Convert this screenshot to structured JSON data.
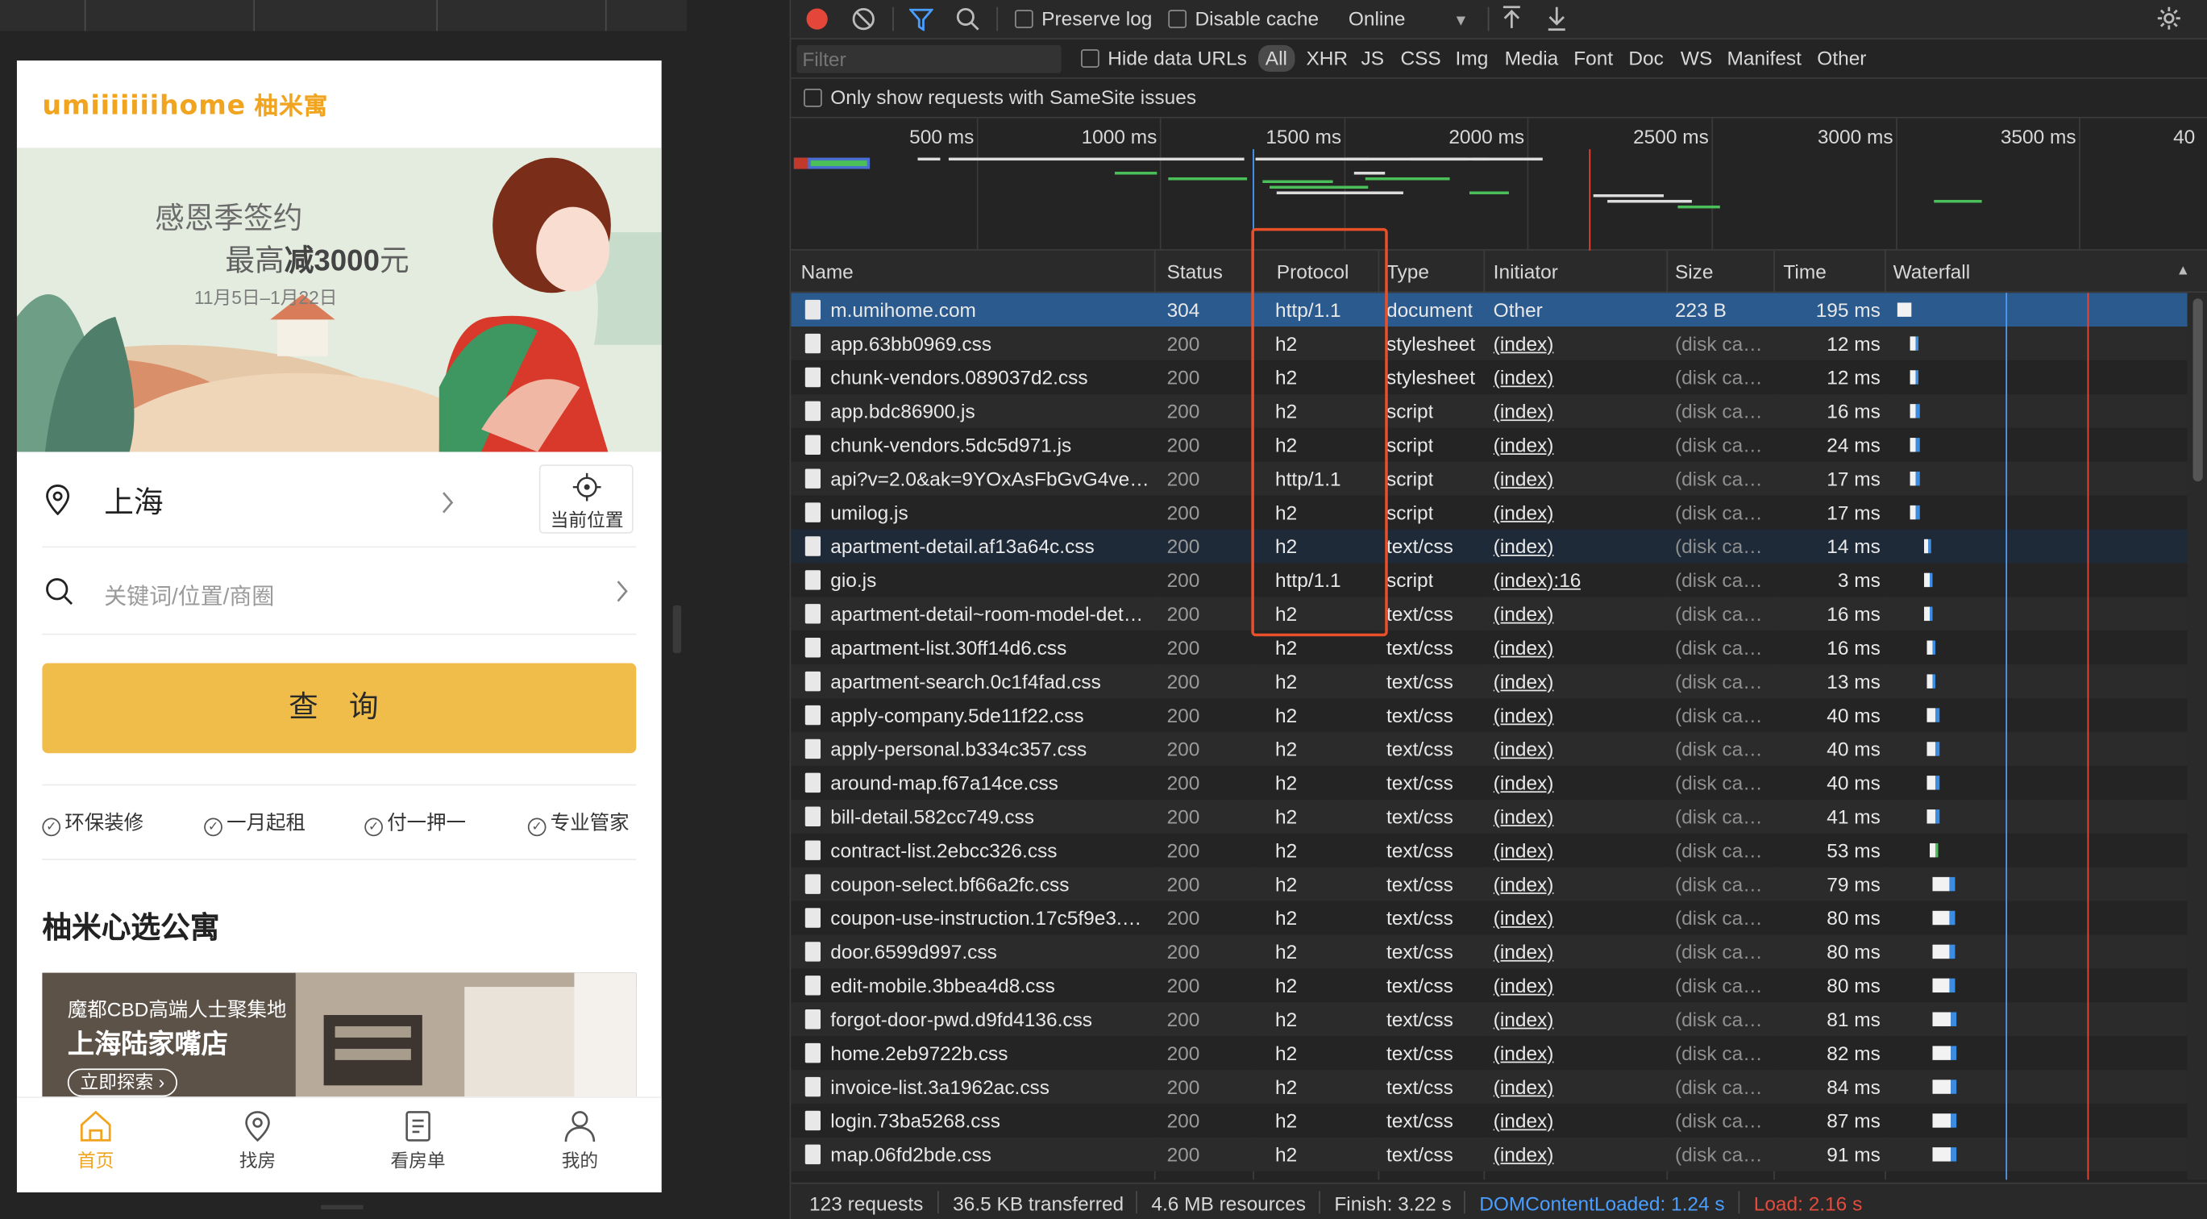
{
  "mobile": {
    "logo_en": "umiiiiiiihome",
    "logo_cn": "柚米寓",
    "banner": {
      "line1": "感恩季签约",
      "line2_prefix": "最高",
      "line2_bold": "减3000",
      "line2_suffix": "元",
      "dates": "11月5日–1月22日"
    },
    "city": "上海",
    "locate_label": "当前位置",
    "search_placeholder": "关键词/位置/商圈",
    "query_button": "查 询",
    "features": [
      "环保装修",
      "一月起租",
      "付一押一",
      "专业管家"
    ],
    "section_title": "柚米心选公寓",
    "card": {
      "subtitle": "魔都CBD高端人士聚集地",
      "title": "上海陆家嘴店",
      "button": "立即探索 ›"
    },
    "tabs": [
      {
        "label": "首页",
        "icon": "home-icon",
        "active": true
      },
      {
        "label": "找房",
        "icon": "map-pin-icon",
        "active": false
      },
      {
        "label": "看房单",
        "icon": "list-doc-icon",
        "active": false
      },
      {
        "label": "我的",
        "icon": "user-icon",
        "active": false
      }
    ],
    "accent_color": "#f0a420",
    "button_color": "#f0bd4a"
  },
  "devtools": {
    "toolbar": {
      "preserve_log": "Preserve log",
      "disable_cache": "Disable cache",
      "throttle": "Online"
    },
    "filter": {
      "placeholder": "Filter",
      "hide_data_urls": "Hide data URLs",
      "types": [
        "All",
        "XHR",
        "JS",
        "CSS",
        "Img",
        "Media",
        "Font",
        "Doc",
        "WS",
        "Manifest",
        "Other"
      ],
      "samesite": "Only show requests with SameSite issues"
    },
    "overview_ticks": [
      "500 ms",
      "1000 ms",
      "1500 ms",
      "2000 ms",
      "2500 ms",
      "3000 ms",
      "3500 ms",
      "40"
    ],
    "columns": [
      "Name",
      "Status",
      "Protocol",
      "Type",
      "Initiator",
      "Size",
      "Time",
      "Waterfall"
    ],
    "rows": [
      {
        "name": "m.umihome.com",
        "status": "304",
        "protocol": "http/1.1",
        "type": "document",
        "initiator": "Other",
        "size": "223 B",
        "time": "195 ms"
      },
      {
        "name": "app.63bb0969.css",
        "status": "200",
        "protocol": "h2",
        "type": "stylesheet",
        "initiator": "(index)",
        "size": "(disk ca…",
        "time": "12 ms"
      },
      {
        "name": "chunk-vendors.089037d2.css",
        "status": "200",
        "protocol": "h2",
        "type": "stylesheet",
        "initiator": "(index)",
        "size": "(disk ca…",
        "time": "12 ms"
      },
      {
        "name": "app.bdc86900.js",
        "status": "200",
        "protocol": "h2",
        "type": "script",
        "initiator": "(index)",
        "size": "(disk ca…",
        "time": "16 ms"
      },
      {
        "name": "chunk-vendors.5dc5d971.js",
        "status": "200",
        "protocol": "h2",
        "type": "script",
        "initiator": "(index)",
        "size": "(disk ca…",
        "time": "24 ms"
      },
      {
        "name": "api?v=2.0&ak=9YOxAsFbGvG4ve…",
        "status": "200",
        "protocol": "http/1.1",
        "type": "script",
        "initiator": "(index)",
        "size": "(disk ca…",
        "time": "17 ms"
      },
      {
        "name": "umilog.js",
        "status": "200",
        "protocol": "h2",
        "type": "script",
        "initiator": "(index)",
        "size": "(disk ca…",
        "time": "17 ms"
      },
      {
        "name": "apartment-detail.af13a64c.css",
        "status": "200",
        "protocol": "h2",
        "type": "text/css",
        "initiator": "(index)",
        "size": "(disk ca…",
        "time": "14 ms"
      },
      {
        "name": "gio.js",
        "status": "200",
        "protocol": "http/1.1",
        "type": "script",
        "initiator": "(index):16",
        "size": "(disk ca…",
        "time": "3 ms"
      },
      {
        "name": "apartment-detail~room-model-det…",
        "status": "200",
        "protocol": "h2",
        "type": "text/css",
        "initiator": "(index)",
        "size": "(disk ca…",
        "time": "16 ms"
      },
      {
        "name": "apartment-list.30ff14d6.css",
        "status": "200",
        "protocol": "h2",
        "type": "text/css",
        "initiator": "(index)",
        "size": "(disk ca…",
        "time": "16 ms"
      },
      {
        "name": "apartment-search.0c1f4fad.css",
        "status": "200",
        "protocol": "h2",
        "type": "text/css",
        "initiator": "(index)",
        "size": "(disk ca…",
        "time": "13 ms"
      },
      {
        "name": "apply-company.5de11f22.css",
        "status": "200",
        "protocol": "h2",
        "type": "text/css",
        "initiator": "(index)",
        "size": "(disk ca…",
        "time": "40 ms"
      },
      {
        "name": "apply-personal.b334c357.css",
        "status": "200",
        "protocol": "h2",
        "type": "text/css",
        "initiator": "(index)",
        "size": "(disk ca…",
        "time": "40 ms"
      },
      {
        "name": "around-map.f67a14ce.css",
        "status": "200",
        "protocol": "h2",
        "type": "text/css",
        "initiator": "(index)",
        "size": "(disk ca…",
        "time": "40 ms"
      },
      {
        "name": "bill-detail.582cc749.css",
        "status": "200",
        "protocol": "h2",
        "type": "text/css",
        "initiator": "(index)",
        "size": "(disk ca…",
        "time": "41 ms"
      },
      {
        "name": "contract-list.2ebcc326.css",
        "status": "200",
        "protocol": "h2",
        "type": "text/css",
        "initiator": "(index)",
        "size": "(disk ca…",
        "time": "53 ms"
      },
      {
        "name": "coupon-select.bf66a2fc.css",
        "status": "200",
        "protocol": "h2",
        "type": "text/css",
        "initiator": "(index)",
        "size": "(disk ca…",
        "time": "79 ms"
      },
      {
        "name": "coupon-use-instruction.17c5f9e3.…",
        "status": "200",
        "protocol": "h2",
        "type": "text/css",
        "initiator": "(index)",
        "size": "(disk ca…",
        "time": "80 ms"
      },
      {
        "name": "door.6599d997.css",
        "status": "200",
        "protocol": "h2",
        "type": "text/css",
        "initiator": "(index)",
        "size": "(disk ca…",
        "time": "80 ms"
      },
      {
        "name": "edit-mobile.3bbea4d8.css",
        "status": "200",
        "protocol": "h2",
        "type": "text/css",
        "initiator": "(index)",
        "size": "(disk ca…",
        "time": "80 ms"
      },
      {
        "name": "forgot-door-pwd.d9fd4136.css",
        "status": "200",
        "protocol": "h2",
        "type": "text/css",
        "initiator": "(index)",
        "size": "(disk ca…",
        "time": "81 ms"
      },
      {
        "name": "home.2eb9722b.css",
        "status": "200",
        "protocol": "h2",
        "type": "text/css",
        "initiator": "(index)",
        "size": "(disk ca…",
        "time": "82 ms"
      },
      {
        "name": "invoice-list.3a1962ac.css",
        "status": "200",
        "protocol": "h2",
        "type": "text/css",
        "initiator": "(index)",
        "size": "(disk ca…",
        "time": "84 ms"
      },
      {
        "name": "login.73ba5268.css",
        "status": "200",
        "protocol": "h2",
        "type": "text/css",
        "initiator": "(index)",
        "size": "(disk ca…",
        "time": "87 ms"
      },
      {
        "name": "map.06fd2bde.css",
        "status": "200",
        "protocol": "h2",
        "type": "text/css",
        "initiator": "(index)",
        "size": "(disk ca…",
        "time": "91 ms"
      }
    ],
    "status_bar": {
      "requests": "123 requests",
      "transferred": "36.5 KB transferred",
      "resources": "4.6 MB resources",
      "finish": "Finish: 3.22 s",
      "dom_loaded": "DOMContentLoaded: 1.24 s",
      "load": "Load: 2.16 s"
    },
    "colors": {
      "selected_row": "#2a5a8e",
      "dom_loaded": "#4a9eff",
      "load": "#e54b3c",
      "highlight_box": "#e8502a"
    }
  }
}
